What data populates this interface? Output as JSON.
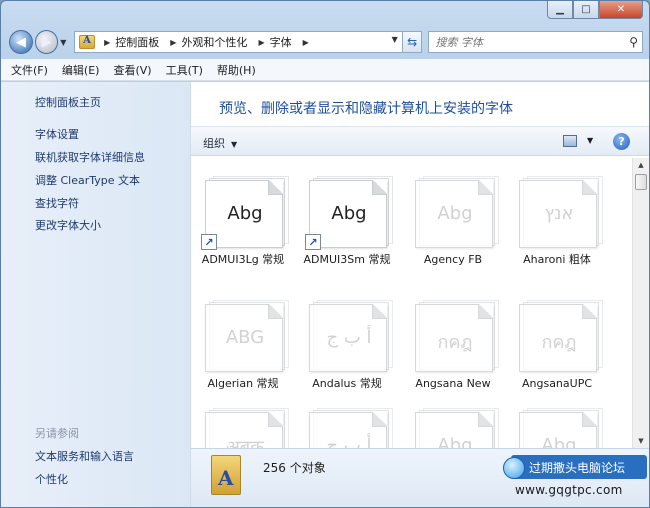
{
  "window": {
    "minimize_glyph": "▁",
    "maximize_glyph": "□",
    "close_glyph": "✕"
  },
  "address": {
    "crumbs": [
      "控制面板",
      "外观和个性化",
      "字体"
    ],
    "search_placeholder": "搜索 字体"
  },
  "menu": [
    "文件(F)",
    "编辑(E)",
    "查看(V)",
    "工具(T)",
    "帮助(H)"
  ],
  "sidebar": {
    "home": "控制面板主页",
    "links": [
      "字体设置",
      "联机获取字体详细信息",
      "调整 ClearType 文本",
      "查找字符",
      "更改字体大小"
    ],
    "see_also_title": "另请参阅",
    "see_also": [
      "文本服务和输入语言",
      "个性化"
    ]
  },
  "main": {
    "title": "预览、删除或者显示和隐藏计算机上安装的字体",
    "organize": "组织",
    "status_count": "256 个对象"
  },
  "fonts": [
    {
      "name": "ADMUI3Lg 常规",
      "sample": "Abg",
      "shortcut": true,
      "faded": false
    },
    {
      "name": "ADMUI3Sm 常规",
      "sample": "Abg",
      "shortcut": true,
      "faded": false
    },
    {
      "name": "Agency FB",
      "sample": "Abg",
      "shortcut": false,
      "faded": true
    },
    {
      "name": "Aharoni 粗体",
      "sample": "אנץ",
      "shortcut": false,
      "faded": true
    },
    {
      "name": "Algerian 常规",
      "sample": "ABG",
      "shortcut": false,
      "faded": true
    },
    {
      "name": "Andalus 常规",
      "sample": "أ ب ج",
      "shortcut": false,
      "faded": true
    },
    {
      "name": "Angsana New",
      "sample": "กคฎ",
      "shortcut": false,
      "faded": true
    },
    {
      "name": "AngsanaUPC",
      "sample": "กคฎ",
      "shortcut": false,
      "faded": true
    },
    {
      "name": "",
      "sample": "अबक",
      "shortcut": false,
      "faded": true
    },
    {
      "name": "",
      "sample": "أ ب ج",
      "shortcut": true,
      "faded": true
    },
    {
      "name": "",
      "sample": "Abg",
      "shortcut": false,
      "faded": true
    },
    {
      "name": "",
      "sample": "Abg",
      "shortcut": false,
      "faded": true
    }
  ],
  "watermark": {
    "title": "过期撒头电脑论坛",
    "url": "www.gqgtpc.com"
  }
}
